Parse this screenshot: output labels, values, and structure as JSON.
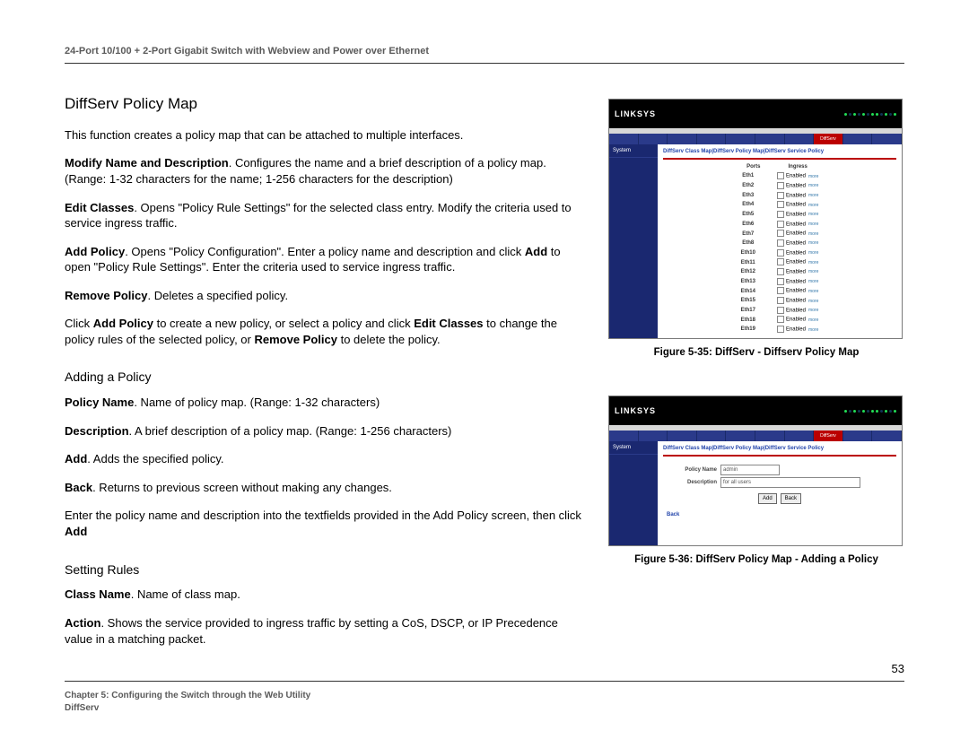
{
  "header": "24-Port 10/100 + 2-Port Gigabit Switch with Webview and Power over Ethernet",
  "section_title": "DiffServ Policy Map",
  "para_intro": "This function creates a policy map that can be attached to multiple interfaces.",
  "modify_label": "Modify Name and Description",
  "modify_text": ". Configures the name and a brief description of a policy map. (Range: 1-32 characters for the name; 1-256 characters for the description)",
  "editc_label": "Edit Classes",
  "editc_text": ". Opens \"Policy Rule Settings\" for the selected class entry. Modify the criteria used to service ingress traffic.",
  "addp_label": "Add Policy",
  "addp_text_1": ". Opens \"Policy Configuration\". Enter a policy name and description and click ",
  "addp_bold": "Add",
  "addp_text_2": " to open \"Policy Rule Settings\". Enter the criteria used to service ingress traffic.",
  "remp_label": "Remove Policy",
  "remp_text": ". Deletes a specified policy.",
  "usage_1": "Click ",
  "usage_b1": "Add Policy",
  "usage_2": " to create a new policy, or select a policy and click ",
  "usage_b2": "Edit Classes",
  "usage_3": " to change the policy rules of the selected policy, or ",
  "usage_b3": "Remove Policy",
  "usage_4": " to delete the policy.",
  "sub1_title": "Adding a Policy",
  "pname_label": "Policy Name",
  "pname_text": ". Name of policy map. (Range: 1-32 characters)",
  "desc_label": "Description",
  "desc_text": ". A brief description of a policy map. (Range: 1-256 characters)",
  "add_label": "Add",
  "add_text": ". Adds the specified policy.",
  "back_label": "Back",
  "back_text": ". Returns to previous screen without making any changes.",
  "add_instr_1": "Enter the policy name and description into the textfields provided in the Add Policy screen, then click ",
  "add_instr_b": "Add",
  "sub2_title": "Setting Rules",
  "cname_label": "Class Name",
  "cname_text": ". Name of class map.",
  "action_label": "Action",
  "action_text": ". Shows the service provided to ingress traffic by setting a CoS, DSCP, or IP Precedence value in a matching packet.",
  "fig1_caption": "Figure 5-35: DiffServ - Diffserv Policy Map",
  "fig2_caption": "Figure 5-36: DiffServ Policy Map - Adding a Policy",
  "page_number": "53",
  "footer_line1": "Chapter 5: Configuring the Switch through the Web Utility",
  "footer_line2": "DiffServ",
  "screenshot": {
    "logo": "LINKSYS",
    "tabs": [
      "",
      "",
      "",
      "",
      "",
      "",
      "",
      "DiffServ",
      "",
      ""
    ],
    "side_label": "System",
    "breadcrumb": "DiffServ Class Map|DiffServ Policy Map|DiffServ Service Policy",
    "table": {
      "col_port": "Ports",
      "col_ingress": "Ingress",
      "ports": [
        "Eth1",
        "Eth2",
        "Eth3",
        "Eth4",
        "Eth5",
        "Eth6",
        "Eth7",
        "Eth8",
        "Eth10",
        "Eth11",
        "Eth12",
        "Eth13",
        "Eth14",
        "Eth15",
        "Eth17",
        "Eth18",
        "Eth19"
      ],
      "cell_label": "Enabled",
      "more_link": "more"
    },
    "form": {
      "pname_label": "Policy Name",
      "pname_value": "admin",
      "desc_label": "Description",
      "desc_value": "for all users",
      "btn_add": "Add",
      "btn_back": "Back",
      "back_link": "Back"
    }
  }
}
